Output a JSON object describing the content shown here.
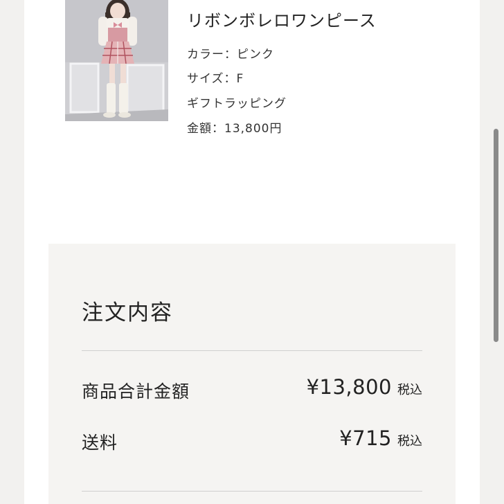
{
  "product": {
    "name": "リボンボレロワンピース",
    "color_line": "カラー：ピンク",
    "size_line": "サイズ：F",
    "gift_line": "ギフトラッピング",
    "price_line": "金額：13,800円"
  },
  "summary": {
    "title": "注文内容",
    "rows": [
      {
        "label": "商品合計金額",
        "amount": "¥13,800",
        "tax": "税込"
      },
      {
        "label": "送料",
        "amount": "¥715",
        "tax": "税込"
      }
    ]
  },
  "colors": {
    "page_background": "#f2f1ef",
    "card_background": "#ffffff",
    "summary_background": "#f5f4f2",
    "divider": "#cfcfcf",
    "text": "#222222",
    "scrollbar": "#8a8a8a"
  }
}
